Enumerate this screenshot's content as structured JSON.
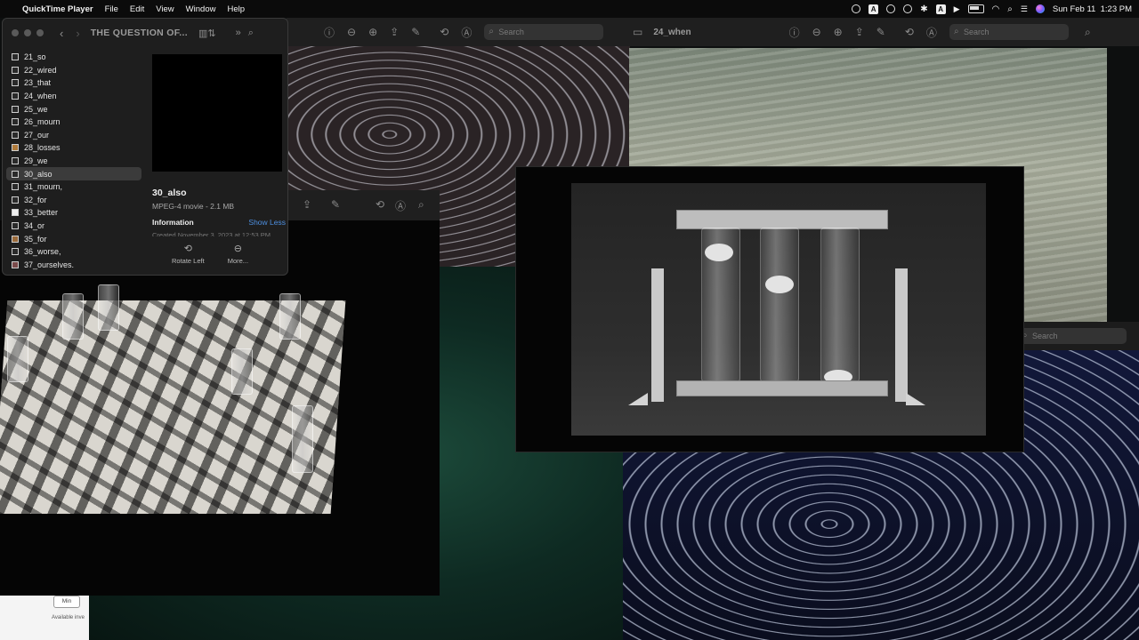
{
  "menubar": {
    "apple_glyph": "",
    "app_name": "QuickTime Player",
    "menus": [
      "File",
      "Edit",
      "View",
      "Window",
      "Help"
    ],
    "status_icons": [
      "hotspot-icon",
      "a-box-icon",
      "vpn-icon",
      "sync-icon",
      "bluetooth-icon",
      "input-source-icon",
      "play-icon",
      "battery-icon",
      "wifi-icon",
      "spotlight-icon",
      "control-center-icon",
      "siri-icon"
    ],
    "input_source": "A",
    "datetime": "Sun Feb 11  1:23 PM"
  },
  "windows": {
    "top_middle": {
      "search_placeholder": "Search"
    },
    "top_right": {
      "title": "24_when",
      "search_placeholder": "Search"
    },
    "right_lower": {
      "search_placeholder": "Search"
    }
  },
  "finder": {
    "title": "THE QUESTION OF...",
    "files": [
      "21_so",
      "22_wired",
      "23_that",
      "24_when",
      "25_we",
      "26_mourn",
      "27_our",
      "28_losses",
      "29_we",
      "30_also",
      "31_mourn,",
      "32_for",
      "33_better",
      "34_or",
      "35_for",
      "36_worse,",
      "37_ourselves."
    ],
    "selected_index": 9,
    "preview": {
      "name": "30_also",
      "meta": "MPEG-4 movie - 2.1 MB",
      "info_label": "Information",
      "show_less": "Show Less",
      "created": "Created    November 3, 2023 at 12:53 PM"
    },
    "actions": [
      {
        "icon": "rotate-left-icon",
        "label": "Rotate Left"
      },
      {
        "icon": "more-icon",
        "label": "More..."
      }
    ]
  },
  "white_window": {
    "chip": "Min",
    "note": "Available inve"
  }
}
